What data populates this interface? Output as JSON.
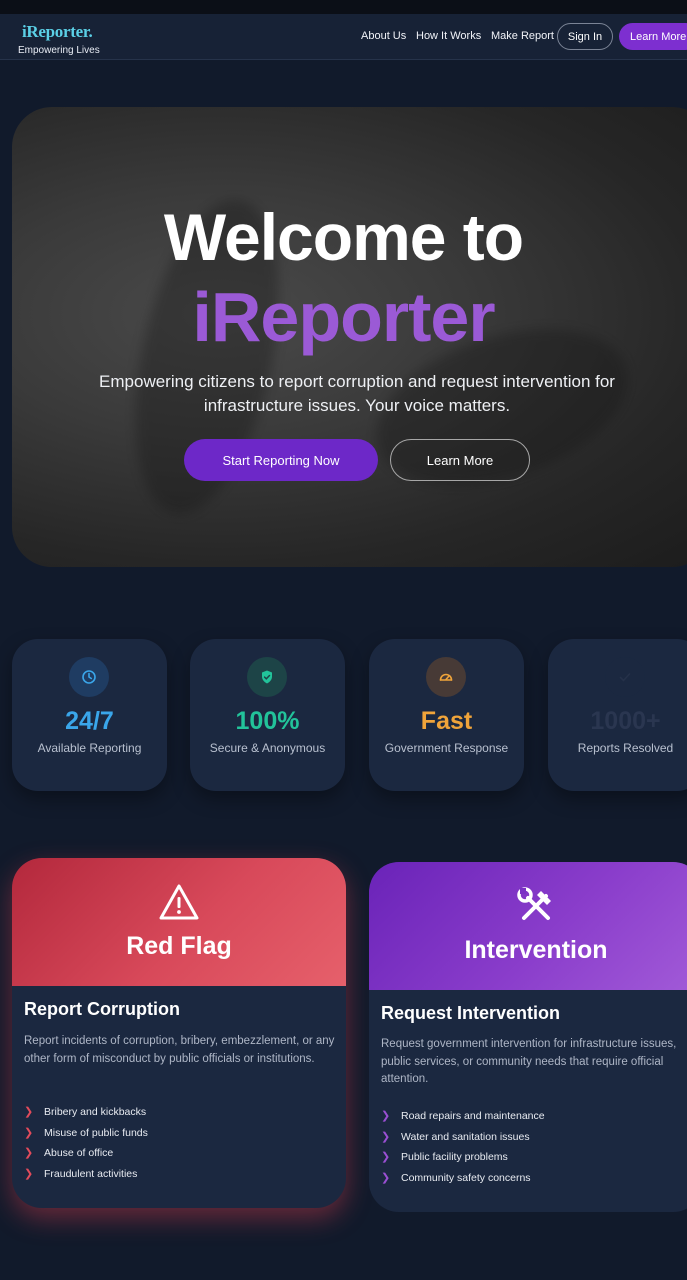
{
  "nav": {
    "logo": "iReporter.",
    "tagline": "Empowering Lives",
    "links": [
      "About Us",
      "How It Works",
      "Make Report"
    ],
    "sign_in": "Sign In",
    "learn_more": "Learn More"
  },
  "hero": {
    "title_line1": "Welcome to",
    "title_line2": "iReporter",
    "subtitle": "Empowering citizens to report corruption and request intervention for infrastructure issues. Your voice matters.",
    "primary_button": "Start Reporting Now",
    "secondary_button": "Learn More"
  },
  "stats": [
    {
      "icon": "clock-icon",
      "value": "24/7",
      "label": "Available Reporting",
      "color": "#3aa6ea"
    },
    {
      "icon": "shield-check-icon",
      "value": "100%",
      "label": "Secure & Anonymous",
      "color": "#22c39a"
    },
    {
      "icon": "speedometer-icon",
      "value": "Fast",
      "label": "Government Response",
      "color": "#f0a43a"
    },
    {
      "icon": "check-icon",
      "value": "1000+",
      "label": "Reports Resolved",
      "color": "#2a3650"
    }
  ],
  "cards": [
    {
      "icon": "warning-triangle-icon",
      "head_title": "Red Flag",
      "heading": "Report Corruption",
      "description": "Report incidents of corruption, bribery, embezzlement, or any other form of misconduct by public officials or institutions.",
      "items": [
        "Bribery and kickbacks",
        "Misuse of public funds",
        "Abuse of office",
        "Fraudulent activities"
      ],
      "accent": "#e24b5b"
    },
    {
      "icon": "hammer-wrench-icon",
      "head_title": "Intervention",
      "heading": "Request Intervention",
      "description": "Request government intervention for infrastructure issues, public services, or community needs that require official attention.",
      "items": [
        "Road repairs and maintenance",
        "Water and sanitation issues",
        "Public facility problems",
        "Community safety concerns"
      ],
      "accent": "#9a4fd3"
    }
  ]
}
